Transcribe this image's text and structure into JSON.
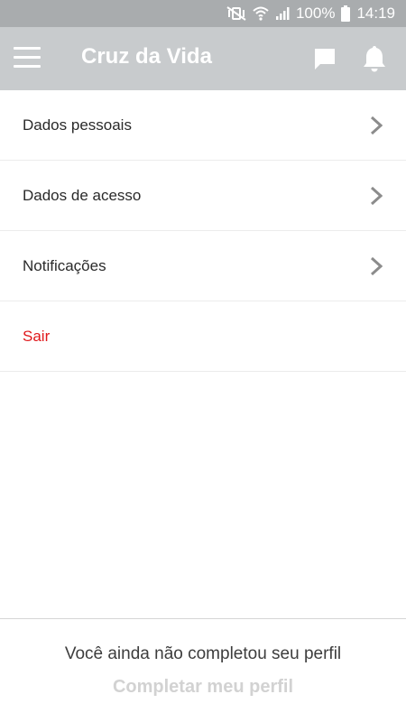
{
  "status_bar": {
    "battery_percent": "100%",
    "time": "14:19",
    "icons": [
      "mute-vibrate-icon",
      "wifi-icon",
      "signal-icon",
      "battery-icon"
    ]
  },
  "app_bar": {
    "title": "Cruz da Vida",
    "icons": [
      "menu-icon",
      "chat-icon",
      "bell-icon"
    ],
    "background": "#c8cbcd"
  },
  "menu": {
    "items": [
      {
        "label": "Dados pessoais",
        "icon": "chevron-right-icon"
      },
      {
        "label": "Dados de acesso",
        "icon": "chevron-right-icon"
      },
      {
        "label": "Notificações",
        "icon": "chevron-right-icon"
      },
      {
        "label": "Sair",
        "color": "#e0181b"
      }
    ]
  },
  "footer": {
    "message": "Você ainda não completou seu perfil",
    "action_label": "Completar meu perfil"
  }
}
